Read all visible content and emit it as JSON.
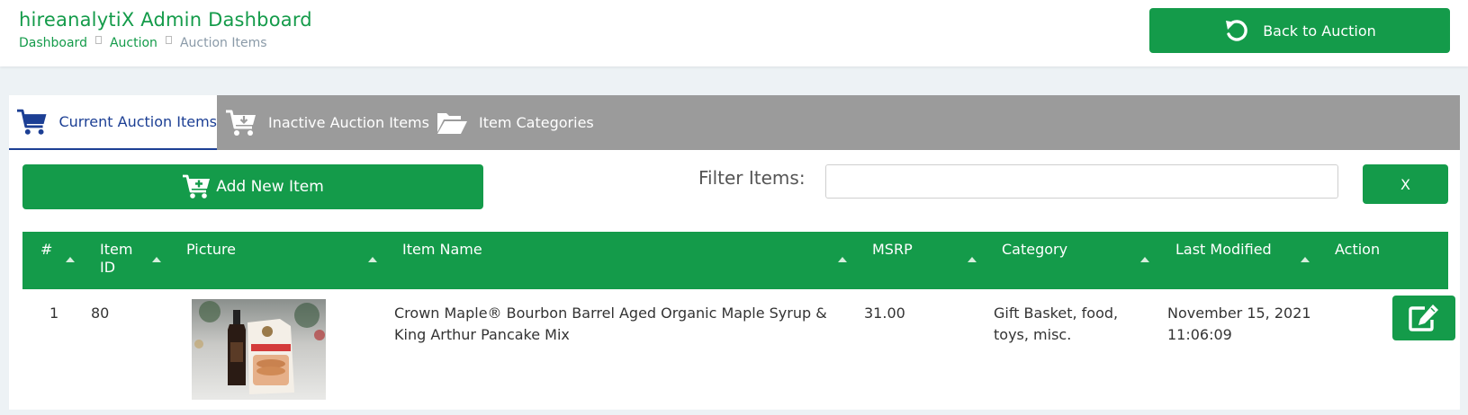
{
  "header": {
    "title": "hireanalytiX Admin Dashboard",
    "breadcrumb": [
      "Dashboard",
      "Auction",
      "Auction Items"
    ],
    "back_button": "Back to Auction"
  },
  "tabs": [
    {
      "label": "Current Auction Items",
      "icon": "cart-icon",
      "active": true
    },
    {
      "label": "Inactive Auction Items",
      "icon": "cart-download-icon",
      "active": false
    },
    {
      "label": "Item Categories",
      "icon": "folder-open-icon",
      "active": false
    }
  ],
  "toolbar": {
    "add_label": "Add New Item",
    "filter_label": "Filter Items:",
    "filter_value": "",
    "clear_label": "X"
  },
  "table": {
    "columns": [
      "#",
      "Item ID",
      "Picture",
      "Item Name",
      "MSRP",
      "Category",
      "Last Modified",
      "Action"
    ],
    "rows": [
      {
        "num": "1",
        "item_id": "80",
        "item_name": "Crown Maple® Bourbon Barrel Aged Organic Maple Syrup & King Arthur Pancake Mix",
        "msrp": "31.00",
        "category": "Gift Basket, food, toys, misc.",
        "last_modified": "November 15, 2021 11:06:09"
      }
    ]
  },
  "colors": {
    "primary": "#149b4a",
    "tab_bar": "#9b9b9b",
    "active_tab_text": "#1c3f94",
    "background": "#edf2f5"
  }
}
